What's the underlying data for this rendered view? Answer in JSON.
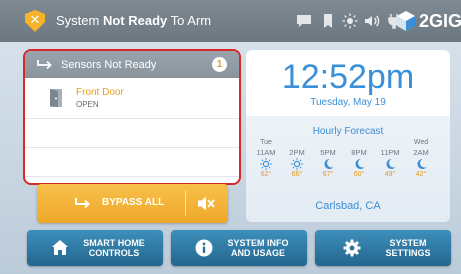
{
  "header": {
    "status_prefix": "System",
    "status_bold": "Not Ready",
    "status_suffix": "To Arm",
    "icons": [
      "message-icon",
      "bookmark-icon",
      "brightness-icon",
      "volume-icon",
      "plug-icon"
    ],
    "logo_text": "2GIG"
  },
  "sensors_panel": {
    "title": "Sensors Not Ready",
    "count": "1",
    "items": [
      {
        "name": "Front Door",
        "state": "OPEN"
      }
    ]
  },
  "bypass": {
    "label": "BYPASS ALL"
  },
  "clock": {
    "time": "12:52pm",
    "date": "Tuesday, May 19"
  },
  "forecast": {
    "title": "Hourly Forecast",
    "location": "Carlsbad, CA",
    "hours": [
      {
        "day": "Tue",
        "time": "11AM",
        "icon": "sun-icon",
        "temp": "62°"
      },
      {
        "day": "",
        "time": "2PM",
        "icon": "sun-icon",
        "temp": "66°"
      },
      {
        "day": "",
        "time": "5PM",
        "icon": "moon-icon",
        "temp": "67°"
      },
      {
        "day": "",
        "time": "8PM",
        "icon": "moon-icon",
        "temp": "60°"
      },
      {
        "day": "",
        "time": "11PM",
        "icon": "moon-icon",
        "temp": "49°"
      },
      {
        "day": "Wed",
        "time": "2AM",
        "icon": "moon-icon",
        "temp": "42°"
      }
    ]
  },
  "bottom_buttons": [
    {
      "line1": "SMART HOME",
      "line2": "CONTROLS",
      "icon": "home-icon"
    },
    {
      "line1": "SYSTEM INFO",
      "line2": "AND USAGE",
      "icon": "info-icon"
    },
    {
      "line1": "SYSTEM",
      "line2": "SETTINGS",
      "icon": "gear-icon"
    }
  ],
  "colors": {
    "accent_blue": "#3b8fd6",
    "warning_yellow": "#f4b32b",
    "alert_red": "#d62a2a",
    "button_blue": "#2f7ba6"
  }
}
